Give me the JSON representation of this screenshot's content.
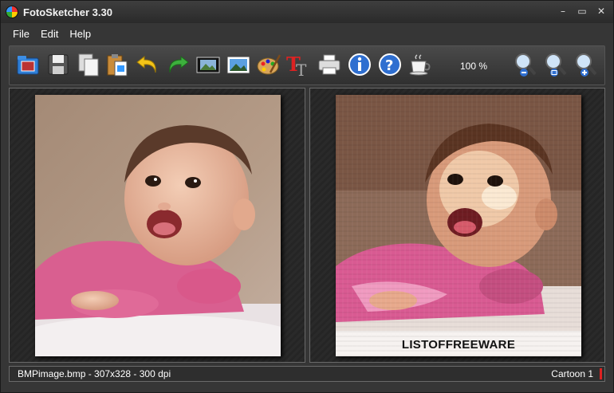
{
  "window": {
    "title": "FotoSketcher 3.30"
  },
  "window_controls": {
    "minimize": "–",
    "maximize": "▭",
    "close": "✕"
  },
  "menu": {
    "items": [
      "File",
      "Edit",
      "Help"
    ]
  },
  "toolbar": {
    "zoom_label": "100 %",
    "buttons": [
      "open-icon",
      "save-icon",
      "copy-icon",
      "paste-icon",
      "undo-icon",
      "redo-icon",
      "film-icon",
      "picture-icon",
      "palette-icon",
      "text-icon",
      "print-icon",
      "info-icon",
      "help-icon",
      "coffee-icon",
      "zoom-out-icon",
      "zoom-fit-icon",
      "zoom-in-icon"
    ]
  },
  "preview": {
    "watermark": "LISTOFFREEWARE"
  },
  "status": {
    "file_info": "BMPimage.bmp - 307x328 - 300 dpi",
    "effect": "Cartoon 1"
  },
  "colors": {
    "background": "#363636",
    "accent_red": "#dd2222"
  }
}
